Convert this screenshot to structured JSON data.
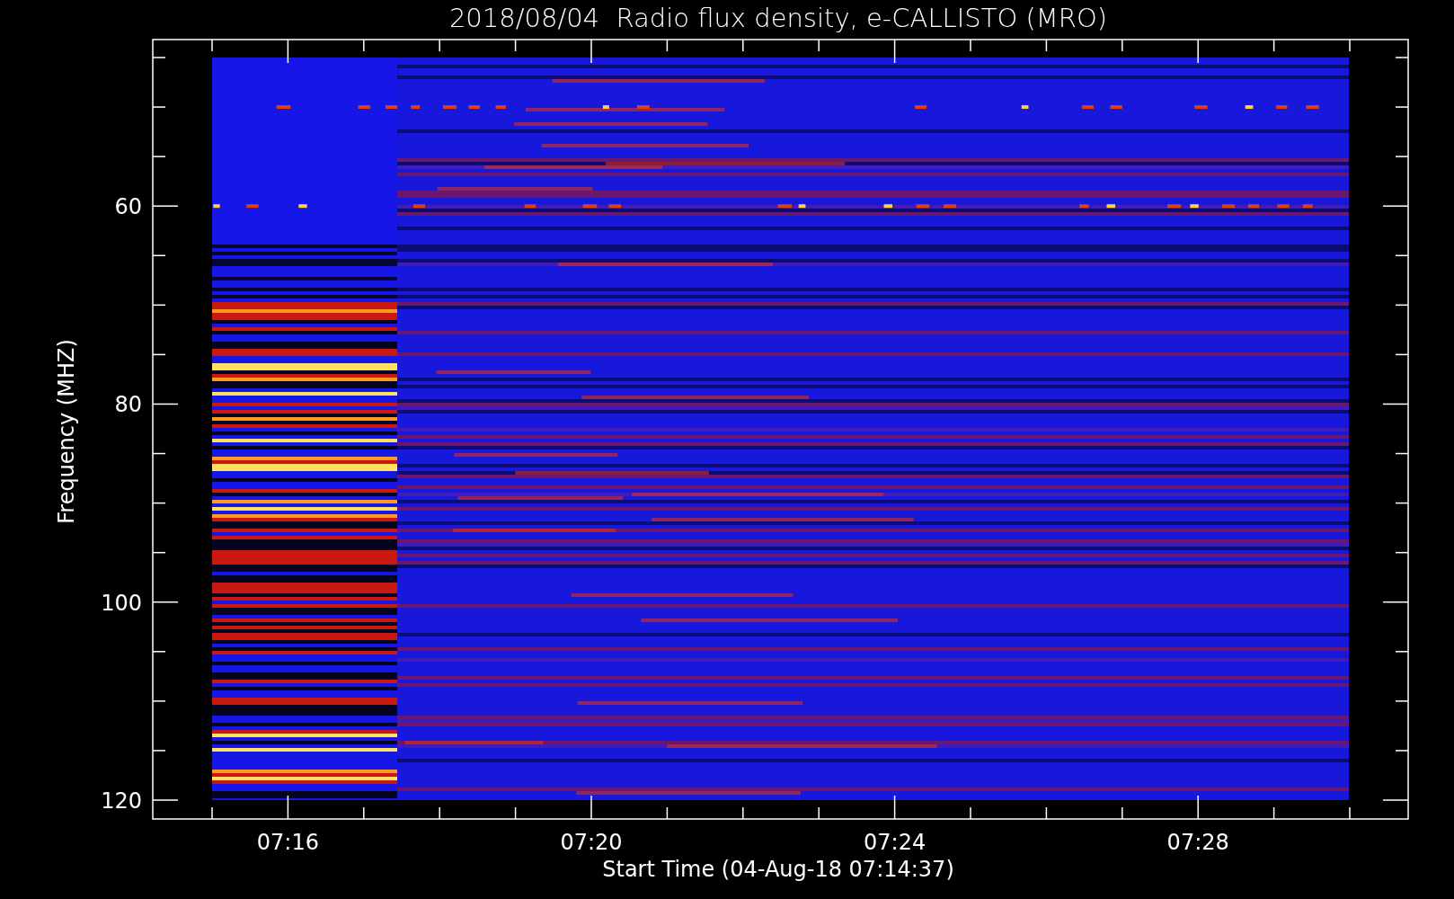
{
  "title": "2018/08/04  Radio flux density, e-CALLISTO (MRO)",
  "y_axis": {
    "label": "Frequency (MHZ)",
    "ticks": [
      "60",
      "80",
      "100",
      "120"
    ]
  },
  "x_axis": {
    "label": "Start Time (04-Aug-18 07:14:37)",
    "ticks": [
      "07:16",
      "07:20",
      "07:24",
      "07:28"
    ]
  }
}
